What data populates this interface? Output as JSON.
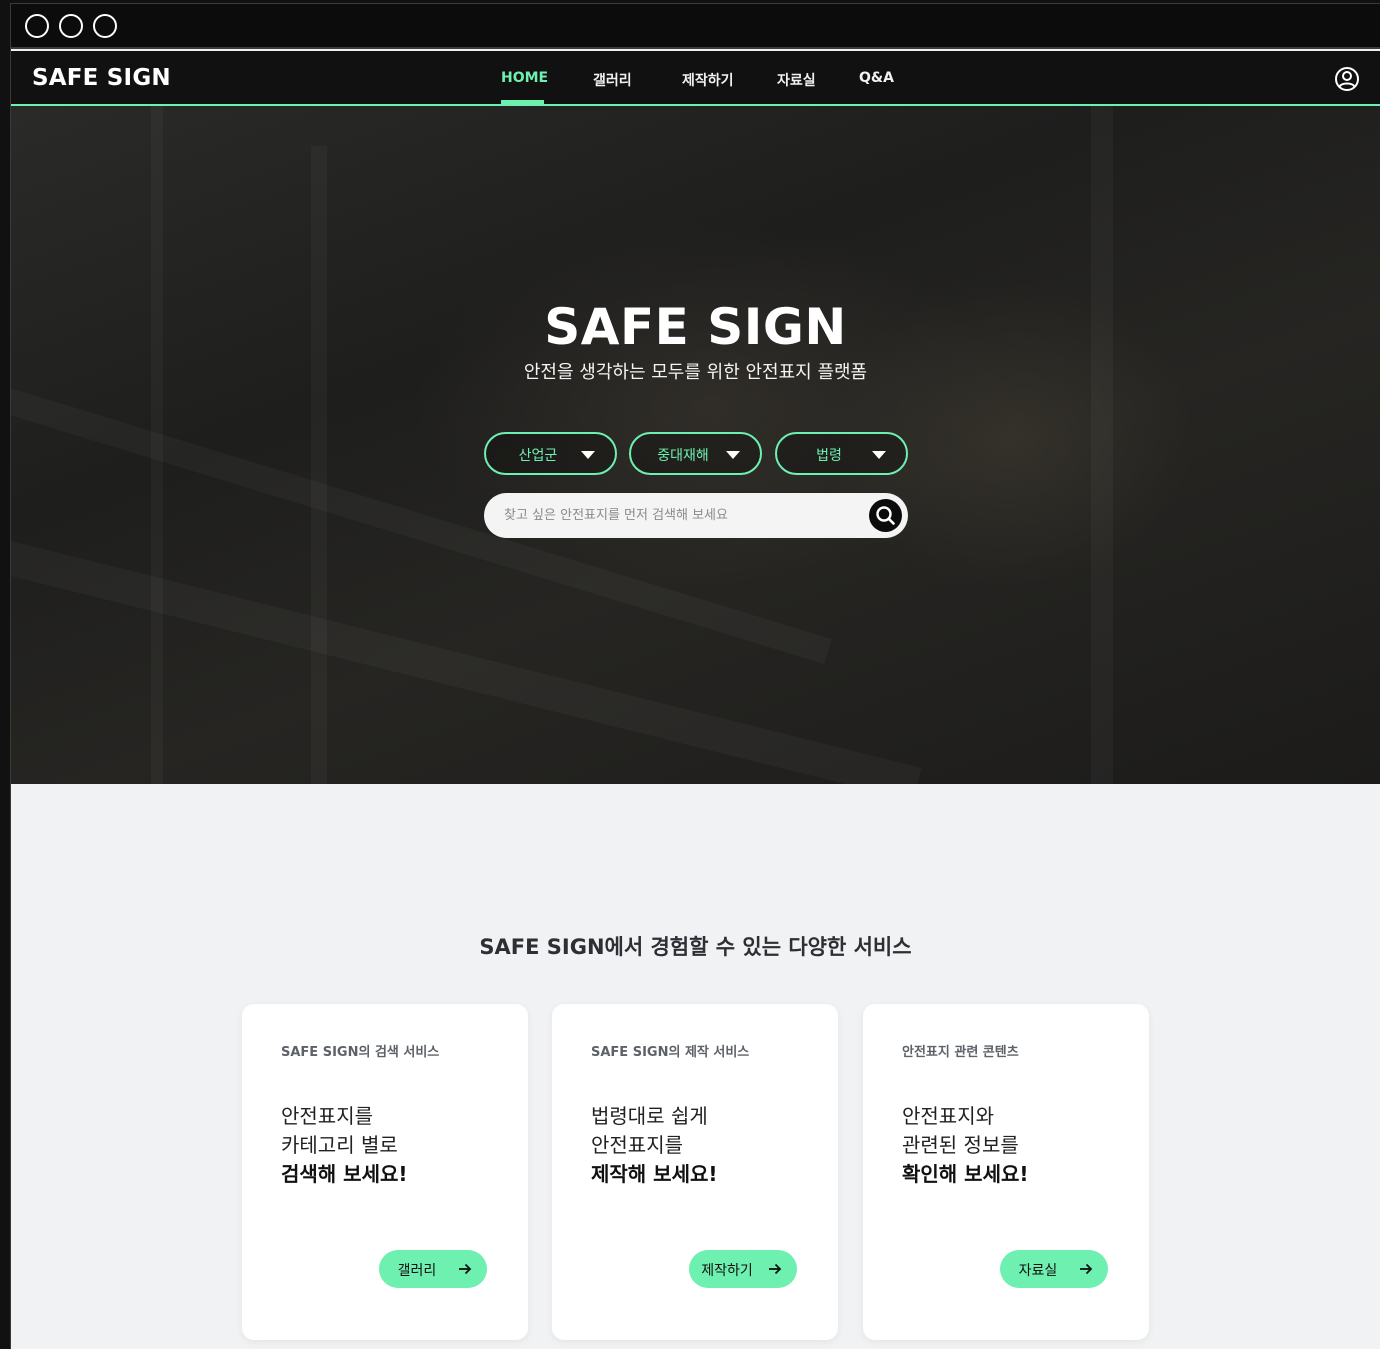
{
  "nav": {
    "logo": "SAFE SIGN",
    "items": [
      {
        "label": "HOME",
        "active": true
      },
      {
        "label": "갤러리",
        "active": false
      },
      {
        "label": "제작하기",
        "active": false
      },
      {
        "label": "자료실",
        "active": false
      },
      {
        "label": "Q&A",
        "active": false
      }
    ],
    "user_icon": "user-circle-icon"
  },
  "hero": {
    "title": "SAFE SIGN",
    "subtitle": "안전을 생각하는 모두를 위한 안전표지 플랫폼",
    "filters": [
      {
        "label": "산업군"
      },
      {
        "label": "중대재해"
      },
      {
        "label": "법령"
      }
    ],
    "search": {
      "value": "",
      "placeholder": "찾고 싶은 안전표지를 먼저 검색해 보세요"
    }
  },
  "services": {
    "title": "SAFE SIGN에서 경험할 수 있는 다양한 서비스",
    "cards": [
      {
        "eyebrow": "SAFE SIGN의 검색 서비스",
        "line1": "안전표지를",
        "line2": "카테고리 별로",
        "line3": "검색해 보세요!",
        "button": "갤러리"
      },
      {
        "eyebrow": "SAFE SIGN의 제작 서비스",
        "line1": "법령대로 쉽게",
        "line2": "안전표지를",
        "line3": "제작해 보세요!",
        "button": "제작하기"
      },
      {
        "eyebrow": "안전표지 관련 콘텐츠",
        "line1": "안전표지와",
        "line2": "관련된 정보를",
        "line3": "확인해 보세요!",
        "button": "자료실"
      }
    ]
  },
  "colors": {
    "accent": "#6ef0b0",
    "nav_bg": "#111111",
    "page_bg": "#f1f2f4"
  }
}
